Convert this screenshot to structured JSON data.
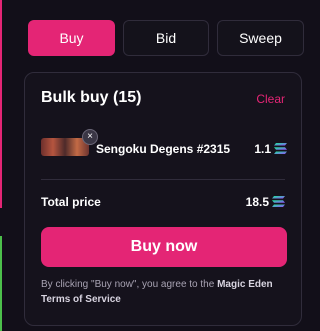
{
  "tabs": [
    {
      "label": "Buy",
      "active": true
    },
    {
      "label": "Bid",
      "active": false
    },
    {
      "label": "Sweep",
      "active": false
    }
  ],
  "panel": {
    "title": "Bulk buy (15)",
    "clear_label": "Clear",
    "items": [
      {
        "name": "Sengoku Degens #2315",
        "price": "1.1",
        "currency_icon": "solana-icon"
      }
    ],
    "remove_icon": "×",
    "total_label": "Total price",
    "total_value": "18.5",
    "buy_button_label": "Buy now",
    "disclaimer_prefix": "By clicking \"Buy now\", you agree to the ",
    "disclaimer_link": "Magic Eden Terms of Service"
  },
  "colors": {
    "accent": "#e42575",
    "background": "#120f19",
    "panel": "#15121c",
    "border": "#302c3b",
    "muted_text": "#a8a3b3",
    "solana_gradient": [
      "#14f195",
      "#9945ff"
    ]
  }
}
